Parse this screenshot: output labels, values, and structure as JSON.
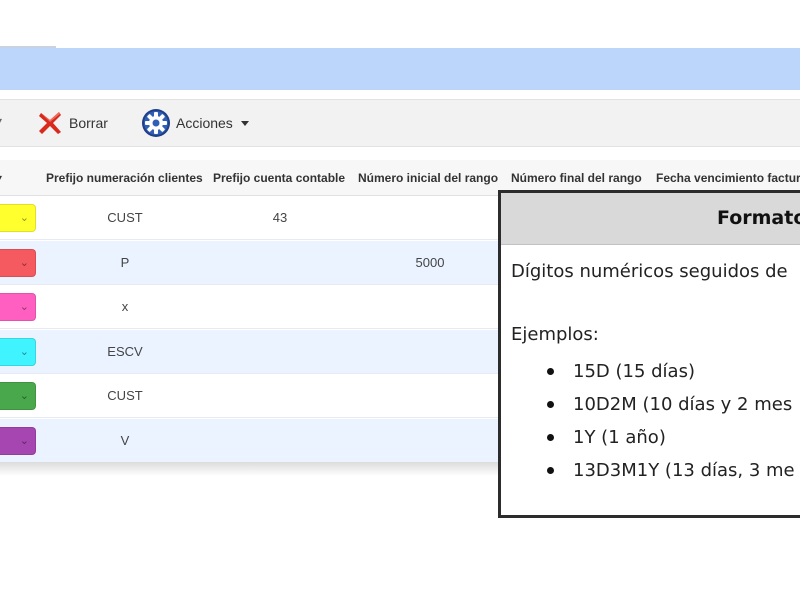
{
  "toolbar": {
    "borrar_label": "Borrar",
    "acciones_label": "Acciones"
  },
  "columns": [
    "Prefijo numeración clientes",
    "Prefijo cuenta contable",
    "Número inicial del rango",
    "Número final del rango",
    "Fecha vencimiento factura"
  ],
  "rows": [
    {
      "color": "#ffff2e",
      "prefijo": "CUST",
      "cuenta": "43",
      "inicial": ""
    },
    {
      "color": "#f55a60",
      "prefijo": "P",
      "cuenta": "",
      "inicial": "5000"
    },
    {
      "color": "#ff5fc0",
      "prefijo": "x",
      "cuenta": "",
      "inicial": ""
    },
    {
      "color": "#3ff4ff",
      "prefijo": "ESCV",
      "cuenta": "",
      "inicial": ""
    },
    {
      "color": "#4aa84c",
      "prefijo": "CUST",
      "cuenta": "",
      "inicial": ""
    },
    {
      "color": "#a546b1",
      "prefijo": "V",
      "cuenta": "",
      "inicial": ""
    }
  ],
  "tooltip": {
    "title": "Formato",
    "description": "Dígitos numéricos seguidos de",
    "examples_label": "Ejemplos:",
    "examples": [
      "15D (15 días)",
      "10D2M (10 días y 2 mes",
      "1Y (1 año)",
      "13D3M1Y (13 días, 3 me"
    ]
  },
  "icons": {
    "delete": "close-x-icon",
    "actions": "gear-icon",
    "dropdown": "caret-down-icon",
    "swatch_dropdown": "chevron-down-icon"
  }
}
